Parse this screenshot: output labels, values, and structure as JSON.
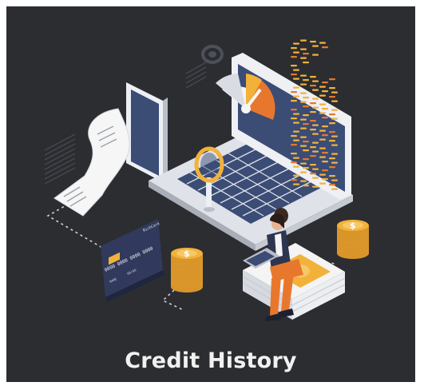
{
  "caption": "Credit History",
  "card": {
    "brand": "RichCard",
    "number": "0000 0000 0000 0000",
    "name": "NAME",
    "expiry": "00/00"
  },
  "colors": {
    "background": "#2b2d31",
    "accent_gold": "#f2b23a",
    "accent_orange": "#e8772e",
    "screen_blue": "#3b4c75",
    "white": "#f4f4f4"
  }
}
